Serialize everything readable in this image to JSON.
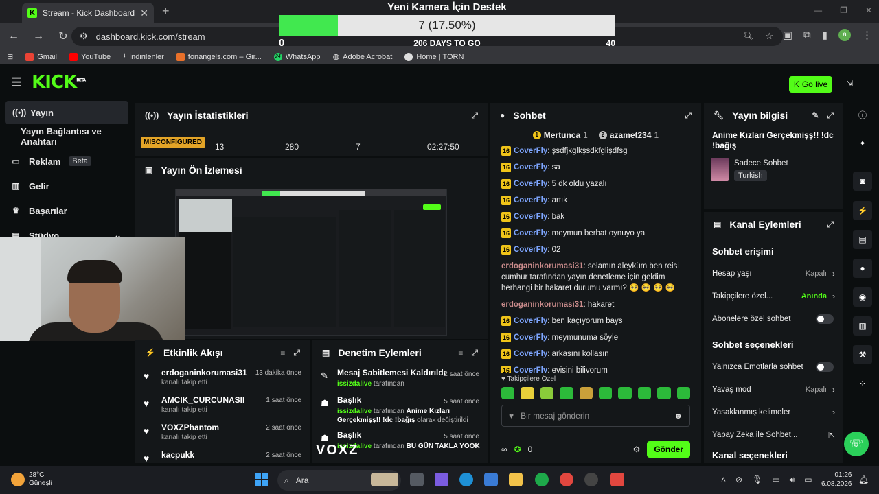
{
  "browser": {
    "tab_title": "Stream - Kick Dashboard",
    "url": "dashboard.kick.com/stream",
    "profile_initial": "a",
    "bookmarks": [
      "Gmail",
      "YouTube",
      "İndirilenler",
      "fonangels.com – Gir...",
      "WhatsApp",
      "Adobe Acrobat",
      "Home | TORN"
    ],
    "whatsapp_badge": "24"
  },
  "goal": {
    "title": "Yeni Kamera İçin Destek",
    "value_text": "7 (17.50%)",
    "progress_fraction": 0.175,
    "min": "0",
    "max": "40",
    "days_left": "206 DAYS TO GO"
  },
  "header": {
    "logo_text": "KICK",
    "logo_beta": "BETA",
    "go_live": "Go live"
  },
  "sidebar": {
    "items": [
      {
        "label": "Yayın",
        "icon": "broadcast-icon"
      },
      {
        "label": "Yayın Bağlantısı ve Anahtarı",
        "icon": "key-icon"
      },
      {
        "label": "Reklam",
        "icon": "ad-icon",
        "badge": "Beta"
      },
      {
        "label": "Gelir",
        "icon": "revenue-icon"
      },
      {
        "label": "Başarılar",
        "icon": "trophy-icon"
      },
      {
        "label": "Stüdyo",
        "icon": "studio-icon"
      }
    ]
  },
  "stats": {
    "title": "Yayın İstatistikleri",
    "status": "MISCONFIGURED",
    "viewers": "13",
    "followers": "280",
    "subs": "7",
    "uptime": "02:27:50"
  },
  "preview": {
    "title": "Yayın Ön İzlemesi"
  },
  "activity": {
    "title": "Etkinlik Akışı",
    "items": [
      {
        "name": "erdoganinkorumasi31",
        "sub": "kanalı takip etti",
        "time": "13 dakika önce"
      },
      {
        "name": "AMCIK_CURCUNASII",
        "sub": "kanalı takip etti",
        "time": "1 saat önce"
      },
      {
        "name": "VOXZPhantom",
        "sub": "kanalı takip etti",
        "time": "2 saat önce"
      },
      {
        "name": "kacpukk",
        "sub": "",
        "time": "2 saat önce"
      }
    ]
  },
  "moderation": {
    "title": "Denetim Eylemleri",
    "items": [
      {
        "title": "Mesaj Sabitlemesi Kaldırıldı",
        "actor": "issizdalive",
        "desc": "tarafından",
        "extra": "",
        "time": "2 saat önce"
      },
      {
        "title": "Başlık",
        "actor": "issizdalive",
        "desc": "tarafından",
        "extra": "Anime Kızları Gerçekmişş!! !dc !bağış",
        "suffix": "olarak değiştirildi",
        "time": "5 saat önce"
      },
      {
        "title": "Başlık",
        "actor": "issizdalive",
        "desc": "tarafından",
        "extra": "BU GÜN TAKLA YOOK",
        "suffix": "",
        "time": "5 saat önce"
      }
    ]
  },
  "chat": {
    "title": "Sohbet",
    "top": [
      {
        "rank": "1",
        "name": "Mertunca",
        "count": "1"
      },
      {
        "rank": "2",
        "name": "azamet234",
        "count": "1"
      }
    ],
    "messages": [
      {
        "lvl": "16",
        "user": "CoverFly",
        "text": "şsdfjkglkşsdkfglişdfsg",
        "cls": ""
      },
      {
        "lvl": "16",
        "user": "CoverFly",
        "text": "sa",
        "cls": ""
      },
      {
        "lvl": "16",
        "user": "CoverFly",
        "text": "5 dk oldu yazalı",
        "cls": ""
      },
      {
        "lvl": "16",
        "user": "CoverFly",
        "text": "artık",
        "cls": ""
      },
      {
        "lvl": "16",
        "user": "CoverFly",
        "text": "bak",
        "cls": ""
      },
      {
        "lvl": "16",
        "user": "CoverFly",
        "text": "meymun berbat oynuyo ya",
        "cls": ""
      },
      {
        "lvl": "16",
        "user": "CoverFly",
        "text": "02",
        "cls": ""
      },
      {
        "lvl": "",
        "user": "erdoganinkorumasi31",
        "text": "selamın aleyküm ben reisi cumhur tarafından yayın denetleme için geldim herhangi bir hakaret durumu varmı? 🥺 🥺 🥺 🥺",
        "cls": "red"
      },
      {
        "lvl": "",
        "user": "erdoganinkorumasi31",
        "text": "hakaret",
        "cls": "red"
      },
      {
        "lvl": "16",
        "user": "CoverFly",
        "text": "ben kaçıyorum bays",
        "cls": ""
      },
      {
        "lvl": "16",
        "user": "CoverFly",
        "text": "meymunuma söyle",
        "cls": ""
      },
      {
        "lvl": "16",
        "user": "CoverFly",
        "text": "arkasını kollasın",
        "cls": ""
      },
      {
        "lvl": "16",
        "user": "CoverFly",
        "text": "evisini biliyorum",
        "cls": ""
      }
    ],
    "followers_only": "Takipçilere Özel",
    "placeholder": "Bir mesaj gönderin",
    "points": "0",
    "send": "Gönder"
  },
  "stream_info": {
    "title": "Yayın bilgisi",
    "stream_title": "Anime Kızları Gerçekmişş!! !dc !bağış",
    "category": "Sadece Sohbet",
    "language": "Turkish"
  },
  "channel_actions": {
    "title": "Kanal Eylemleri",
    "chat_access": "Sohbet erişimi",
    "account_age": {
      "label": "Hesap yaşı",
      "value": "Kapalı"
    },
    "followers_only": {
      "label": "Takipçilere özel...",
      "value": "Anında"
    },
    "subs_only": {
      "label": "Abonelere özel sohbet"
    },
    "chat_options": "Sohbet seçenekleri",
    "emote_only": {
      "label": "Yalnızca Emotlarla sohbet"
    },
    "slow_mode": {
      "label": "Yavaş mod",
      "value": "Kapalı"
    },
    "banned_words": {
      "label": "Yasaklanmış kelimeler"
    },
    "ai_chat": {
      "label": "Yapay Zeka ile Sohbet..."
    },
    "channel_options": "Kanal seçenekleri"
  },
  "webcam_watermark": "VOXZ",
  "taskbar": {
    "temp": "28°C",
    "weather": "Güneşli",
    "search": "Ara",
    "time": "01:26",
    "date": "6.08.2026"
  }
}
